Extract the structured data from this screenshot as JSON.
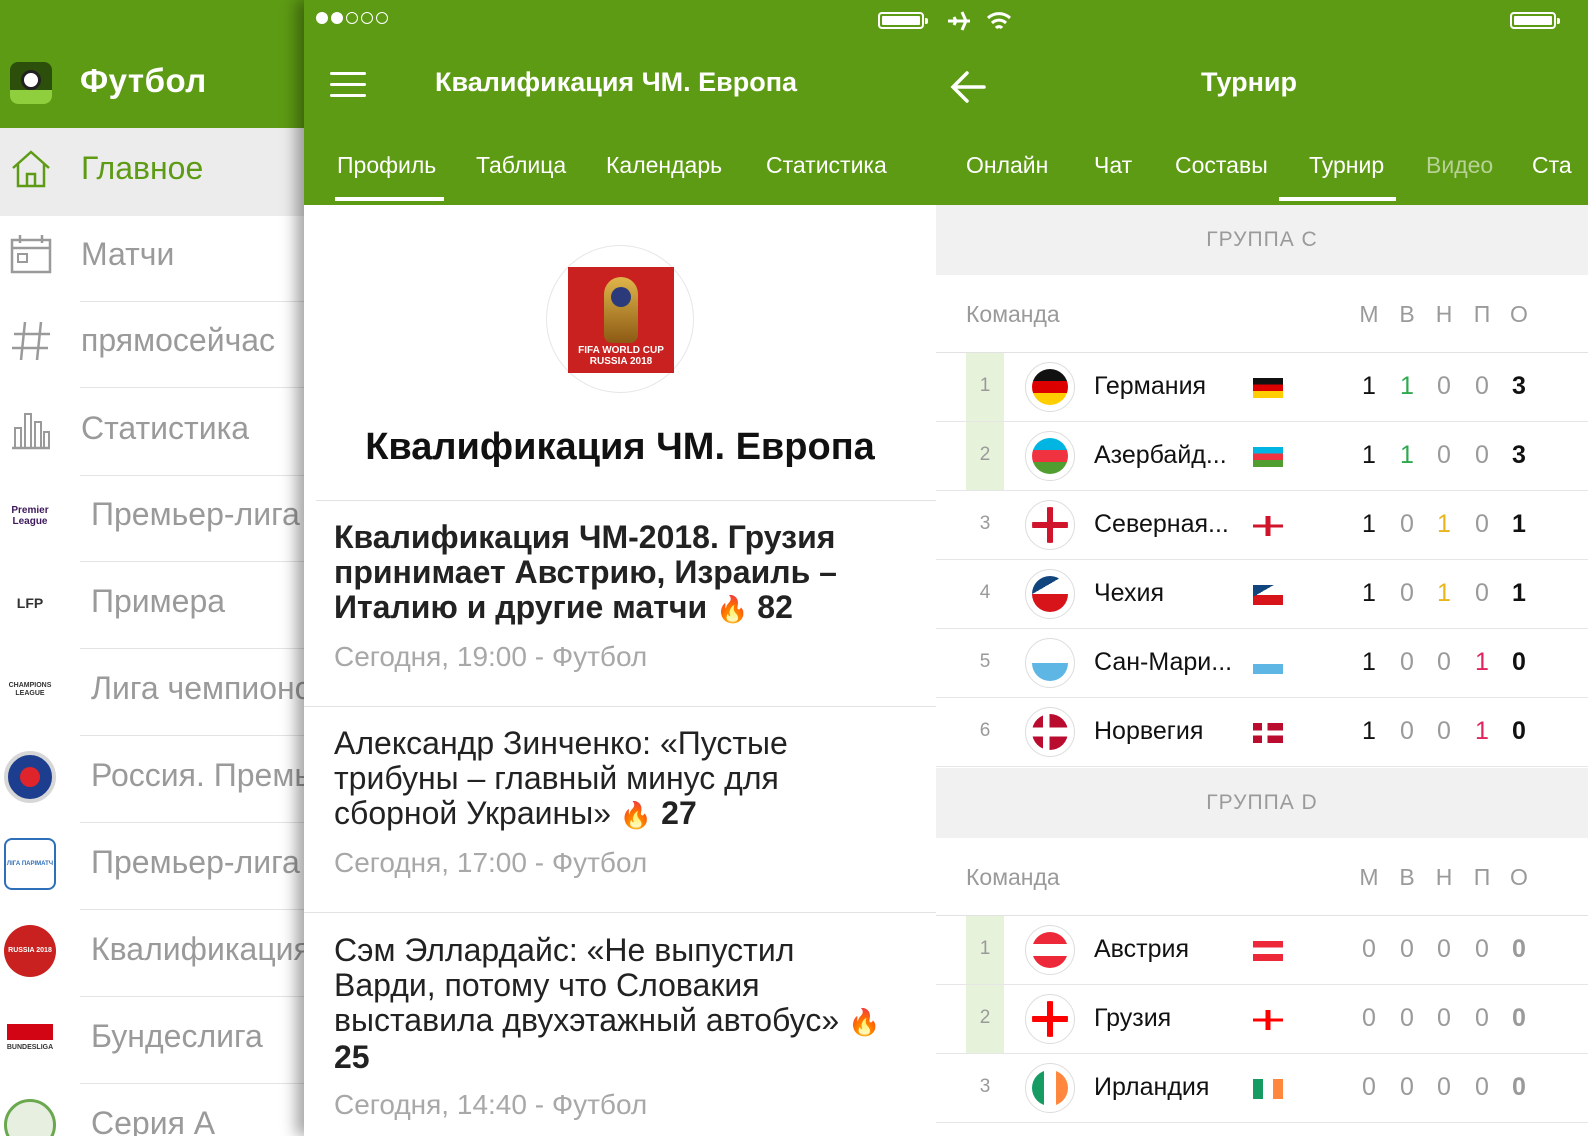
{
  "menu": {
    "app_title": "Футбол",
    "items": [
      {
        "label": "Главное",
        "icon": "home-icon",
        "active": true
      },
      {
        "label": "Матчи",
        "icon": "calendar-icon"
      },
      {
        "label": "прямосейчас",
        "icon": "hashtag-icon"
      },
      {
        "label": "Статистика",
        "icon": "bar-chart-icon"
      }
    ],
    "leagues": [
      {
        "label": "Премьер-лига",
        "logo": "premier-league-logo",
        "logo_text": "Premier League"
      },
      {
        "label": "Примера",
        "logo": "lfp-logo",
        "logo_text": "LFP"
      },
      {
        "label": "Лига чемпионов",
        "logo": "champions-league-logo",
        "logo_text": "CHAMPIONS LEAGUE"
      },
      {
        "label": "Россия. Премьер-лига",
        "logo": "russia-premier-logo",
        "logo_text": ""
      },
      {
        "label": "Премьер-лига",
        "logo": "ukraine-premier-logo",
        "logo_text": "ЛІГА ПАРІМАТЧ"
      },
      {
        "label": "Квалификация ЧМ",
        "logo": "world-cup-logo",
        "logo_text": "RUSSIA 2018"
      },
      {
        "label": "Бундеслига",
        "logo": "bundesliga-logo",
        "logo_text": "BUNDESLIGA"
      },
      {
        "label": "Серия А",
        "logo": "serie-a-logo",
        "logo_text": ""
      }
    ]
  },
  "profile": {
    "header_title": "Квалификация ЧМ. Европа",
    "tabs": [
      "Профиль",
      "Таблица",
      "Календарь",
      "Статистика"
    ],
    "active_tab": "Профиль",
    "logo_text": "FIFA WORLD CUP RUSSIA 2018",
    "title": "Квалификация ЧМ. Европа",
    "news": [
      {
        "title": "Квалификация ЧМ-2018. Грузия принимает Австрию, Израиль – Италию и другие матчи",
        "hot": "82",
        "meta": "Сегодня, 19:00 - Футбол",
        "bold": true
      },
      {
        "title": "Александр Зинченко: «Пустые трибуны – главный минус для сборной Украины»",
        "hot": "27",
        "meta": "Сегодня, 17:00 - Футбол",
        "bold": false
      },
      {
        "title": "Сэм Эллардайс: «Не выпустил Варди, потому что Словакия выставила двухэтажный автобус»",
        "hot": "25",
        "meta": "Сегодня, 14:40 - Футбол",
        "bold": false
      }
    ]
  },
  "tournament": {
    "header_title": "Турнир",
    "tabs": [
      "Онлайн",
      "Чат",
      "Составы",
      "Турнир",
      "Видео",
      "Ста"
    ],
    "active_tab": "Турнир",
    "columns": {
      "team": "Команда",
      "m": "М",
      "w": "В",
      "d": "Н",
      "l": "П",
      "pts": "О"
    },
    "groups": [
      {
        "name": "ГРУППА C",
        "rows": [
          {
            "pos": "1",
            "team": "Германия",
            "flag": "germany-flag",
            "m": "1",
            "w": "1",
            "d": "0",
            "l": "0",
            "pts": "3"
          },
          {
            "pos": "2",
            "team": "Азербайд...",
            "flag": "azerbaijan-flag",
            "m": "1",
            "w": "1",
            "d": "0",
            "l": "0",
            "pts": "3"
          },
          {
            "pos": "3",
            "team": "Северная...",
            "flag": "northern-ireland-flag",
            "m": "1",
            "w": "0",
            "d": "1",
            "l": "0",
            "pts": "1"
          },
          {
            "pos": "4",
            "team": "Чехия",
            "flag": "czech-flag",
            "m": "1",
            "w": "0",
            "d": "1",
            "l": "0",
            "pts": "1"
          },
          {
            "pos": "5",
            "team": "Сан-Мари...",
            "flag": "san-marino-flag",
            "m": "1",
            "w": "0",
            "d": "0",
            "l": "1",
            "pts": "0"
          },
          {
            "pos": "6",
            "team": "Норвегия",
            "flag": "norway-flag",
            "m": "1",
            "w": "0",
            "d": "0",
            "l": "1",
            "pts": "0"
          }
        ]
      },
      {
        "name": "ГРУППА D",
        "rows": [
          {
            "pos": "1",
            "team": "Австрия",
            "flag": "austria-flag",
            "m": "0",
            "w": "0",
            "d": "0",
            "l": "0",
            "pts": "0"
          },
          {
            "pos": "2",
            "team": "Грузия",
            "flag": "georgia-flag",
            "m": "0",
            "w": "0",
            "d": "0",
            "l": "0",
            "pts": "0"
          },
          {
            "pos": "3",
            "team": "Ирландия",
            "flag": "ireland-flag",
            "m": "0",
            "w": "0",
            "d": "0",
            "l": "0",
            "pts": "0"
          }
        ]
      }
    ]
  },
  "colors": {
    "brand_green": "#5e9b14",
    "win": "#2fa84f",
    "draw": "#e8b61a",
    "loss": "#e0245e"
  }
}
